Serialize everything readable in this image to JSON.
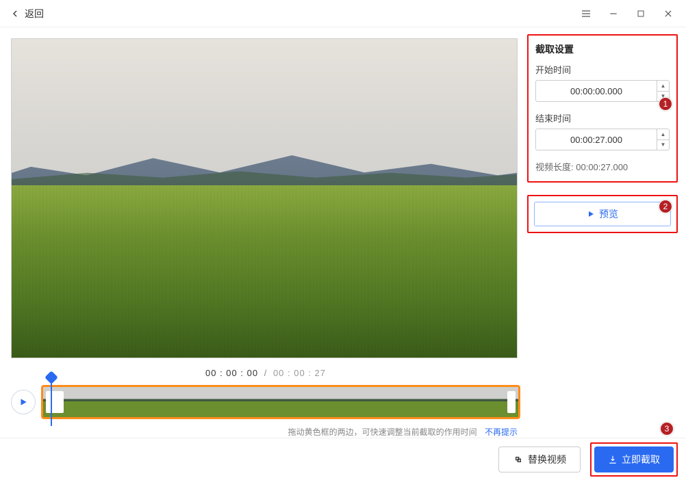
{
  "titlebar": {
    "back": "返回"
  },
  "settings": {
    "title": "截取设置",
    "start_label": "开始时间",
    "start_value": "00:00:00.000",
    "end_label": "结束时间",
    "end_value": "00:00:27.000",
    "length_label": "视频长度:",
    "length_value": "00:00:27.000"
  },
  "preview_button": "预览",
  "playback": {
    "current": "00 : 00 : 00",
    "duration": "00 : 00 : 27"
  },
  "hint": {
    "text": "拖动黄色框的两边，可快速调整当前截取的作用时间",
    "link": "不再提示"
  },
  "footer": {
    "replace": "替换视频",
    "cut": "立即截取"
  },
  "callouts": {
    "c1": "1",
    "c2": "2",
    "c3": "3"
  }
}
